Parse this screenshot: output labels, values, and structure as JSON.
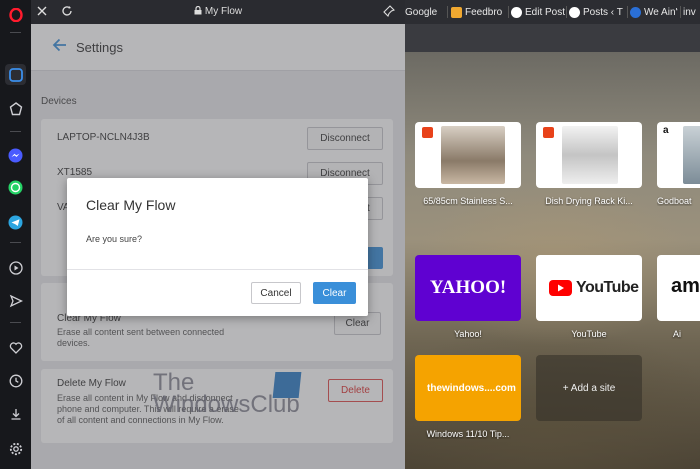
{
  "panel": {
    "title": "My Flow",
    "header_title": "Settings",
    "devices_label": "Devices",
    "devices": [
      {
        "name": "LAPTOP-NCLN4J3B",
        "action": "Disconnect"
      },
      {
        "name": "XT1585",
        "action": "Disconnect"
      },
      {
        "name": "VA",
        "action": "Disconnect"
      }
    ],
    "clear_card": {
      "title": "Clear My Flow",
      "description": [
        "Erase all content sent between connected",
        "devices."
      ],
      "button": "Clear"
    },
    "delete_card": {
      "title": "Delete My Flow",
      "description": [
        "Erase all content in My Flow and disconnect",
        "phone and computer. This will require a erase",
        "of all content and connections in My Flow."
      ],
      "button": "Delete"
    }
  },
  "dialog": {
    "title": "Clear My Flow",
    "message": "Are you sure?",
    "cancel_label": "Cancel",
    "confirm_label": "Clear"
  },
  "tabs": [
    {
      "label": "Google",
      "icon": "google-icon"
    },
    {
      "label": "Feedbro",
      "icon": "feedbro-icon"
    },
    {
      "label": "Edit Post",
      "icon": "wordpress-icon"
    },
    {
      "label": "Posts ‹ T",
      "icon": "wordpress-icon"
    },
    {
      "label": "We Ain't",
      "icon": "site-icon"
    },
    {
      "label": "inv",
      "icon": "site-icon"
    }
  ],
  "speed_dial": [
    {
      "label": "65/85cm Stainless S...",
      "kind": "aliexpress"
    },
    {
      "label": "Dish Drying Rack Ki...",
      "kind": "aliexpress"
    },
    {
      "label": "Godboat",
      "kind": "amazon",
      "badge": "a"
    },
    {
      "label": "Yahoo!",
      "kind": "logo",
      "logo": "YAHOO!"
    },
    {
      "label": "YouTube",
      "kind": "logo",
      "logo": "YouTube"
    },
    {
      "label": "Ai",
      "kind": "logo",
      "logo": "am"
    },
    {
      "label": "Windows 11/10 Tip...",
      "kind": "logo",
      "logo": "thewindows....com"
    },
    {
      "label": "",
      "kind": "add",
      "add_text": "+ Add a site"
    }
  ],
  "watermark": {
    "line1": "The",
    "line2": "WindowsClub"
  },
  "colors": {
    "accent_blue": "#3a8fd9",
    "danger_red": "#e04a4a",
    "yahoo_purple": "#5f01d1",
    "youtube_red": "#ff0000",
    "windows_orange": "#f5a300",
    "sidebar_active": "#3b8eea"
  }
}
